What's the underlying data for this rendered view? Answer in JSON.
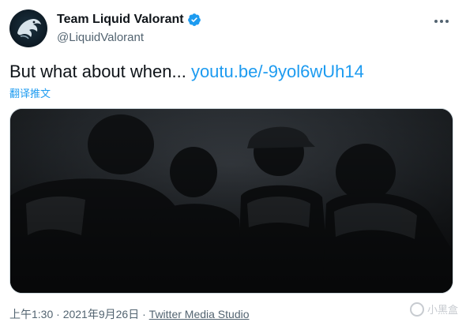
{
  "author": {
    "display_name": "Team Liquid Valorant",
    "handle": "@LiquidValorant",
    "verified": true
  },
  "tweet": {
    "text": "But what about when... ",
    "link": "youtu.be/-9yol6wUh14",
    "translate_label": "翻译推文"
  },
  "meta": {
    "time": "上午1:30",
    "separator": " · ",
    "date": "2021年9月26日",
    "source": "Twitter Media Studio"
  },
  "watermark": {
    "text": "小黑盒"
  },
  "colors": {
    "link": "#1d9bf0",
    "verified": "#1d9bf0",
    "secondary_text": "#536471"
  },
  "icons": {
    "verified": "verified-badge-icon",
    "more": "more-options-icon",
    "avatar": "team-liquid-horse-logo"
  }
}
